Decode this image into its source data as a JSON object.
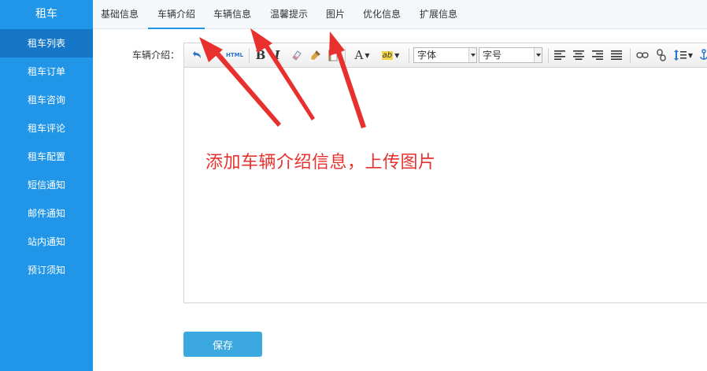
{
  "sidebar": {
    "title": "租车",
    "items": [
      {
        "label": "租车列表",
        "active": true
      },
      {
        "label": "租车订单"
      },
      {
        "label": "租车咨询"
      },
      {
        "label": "租车评论"
      },
      {
        "label": "租车配置"
      },
      {
        "label": "短信通知"
      },
      {
        "label": "邮件通知"
      },
      {
        "label": "站内通知"
      },
      {
        "label": "预订须知"
      }
    ]
  },
  "tabs": [
    {
      "label": "基础信息"
    },
    {
      "label": "车辆介绍",
      "active": true
    },
    {
      "label": "车辆信息"
    },
    {
      "label": "温馨提示"
    },
    {
      "label": "图片"
    },
    {
      "label": "优化信息"
    },
    {
      "label": "扩展信息"
    }
  ],
  "form": {
    "intro_label": "车辆介绍：",
    "save_label": "保存"
  },
  "editor": {
    "toolbar": {
      "html_label": "HTML",
      "bold_label": "B",
      "italic_label": "I",
      "font_color_label": "A",
      "highlight_label": "ab",
      "font_family_value": "字体",
      "font_size_value": "字号",
      "icons": [
        "undo-icon",
        "redo-icon",
        "html-icon",
        "bold-icon",
        "italic-icon",
        "eraser-icon",
        "format-brush-icon",
        "paste-icon",
        "font-color-icon",
        "highlight-icon",
        "align-left-icon",
        "align-center-icon",
        "align-right-icon",
        "align-justify-icon",
        "link-icon",
        "unlink-icon",
        "line-height-icon",
        "anchor-icon"
      ]
    }
  },
  "annotation": {
    "text": "添加车辆介绍信息，上传图片",
    "color": "#e8312f"
  },
  "colors": {
    "sidebar_bg": "#2196e8",
    "sidebar_active": "#1677c9",
    "accent": "#2196e8",
    "save_button": "#3ba8e0"
  }
}
